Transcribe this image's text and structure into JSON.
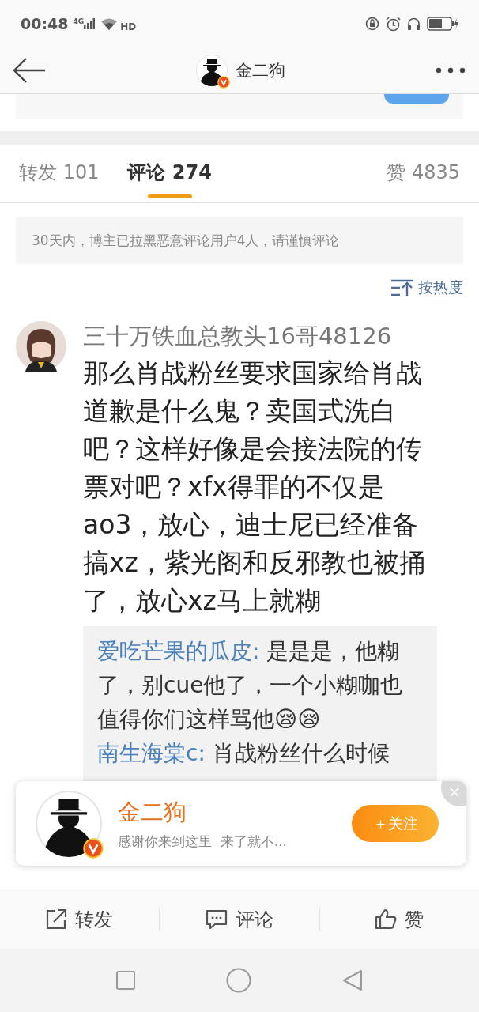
{
  "status_bar": {
    "time": "00:48",
    "network": "4G",
    "call": "HD"
  },
  "header": {
    "title": "金二狗",
    "verified": true
  },
  "tabs": [
    {
      "label": "转发 101",
      "selected": false
    },
    {
      "label": "评论 274",
      "selected": true
    },
    {
      "label": "赞 4835",
      "selected": false
    }
  ],
  "notice": "30天内，博主已拉黑恶意评论用户4人，请谨慎评论",
  "sort": {
    "label": "按热度"
  },
  "comment": {
    "user": "三十万铁血总教头16哥48126",
    "text": "那么肖战粉丝要求国家给肖战道歉是什么鬼？卖国式洗白吧？这样好像是会接法院的传票对吧？xfx得罪的不仅是ao3，放心，迪士尼已经准备搞xz，紫光阁和反邪教也被捅了，放心xz马上就糊",
    "replies": [
      {
        "user": "爱吃芒果的瓜皮:",
        "text": "是是是，他糊了，别cue他了，一个小糊咖也值得你们这样骂他😪😪"
      },
      {
        "user": "南生海棠c:",
        "text": "肖战粉丝什么时候"
      }
    ]
  },
  "follow_popup": {
    "name": "金二狗",
    "bio": "感谢你来到这里  来了就不...",
    "button": "＋关注",
    "verified": true
  },
  "actions": [
    {
      "kind": "share",
      "label": "转发"
    },
    {
      "kind": "comment",
      "label": "评论"
    },
    {
      "kind": "like",
      "label": "赞"
    }
  ]
}
